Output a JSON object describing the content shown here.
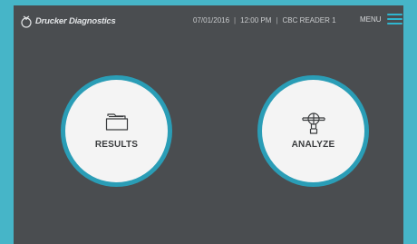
{
  "header": {
    "brand": "Drucker Diagnostics",
    "date": "07/01/2016",
    "time": "12:00 PM",
    "device": "CBC READER 1",
    "separator": "|",
    "menu_label": "MENU"
  },
  "main": {
    "results_label": "RESULTS",
    "analyze_label": "ANALYZE"
  },
  "colors": {
    "accent": "#2a9db6",
    "screen_bg": "#4a4d50",
    "bezel": "#46b5c8",
    "tile_face": "#f4f4f4"
  },
  "icons": {
    "brand": "drucker-logo-icon",
    "menu": "hamburger-menu-icon",
    "results": "folder-icon",
    "analyze": "microscope-reader-icon"
  }
}
